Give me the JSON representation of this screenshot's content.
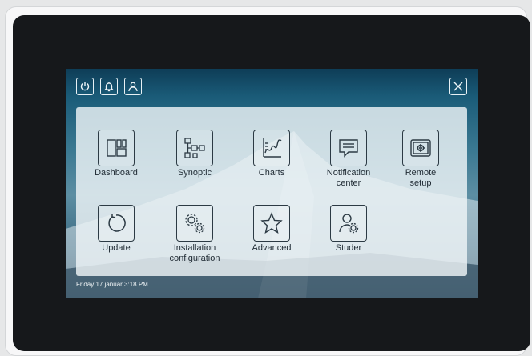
{
  "toolbar": {
    "power_icon": "power-icon",
    "bell_icon": "bell-icon",
    "user_icon": "user-icon",
    "close_icon": "close-icon"
  },
  "tiles": [
    {
      "label": "Dashboard",
      "icon": "dashboard-icon"
    },
    {
      "label": "Synoptic",
      "icon": "synoptic-icon"
    },
    {
      "label": "Charts",
      "icon": "charts-icon"
    },
    {
      "label": "Notification\ncenter",
      "icon": "notification-icon"
    },
    {
      "label": "Remote\nsetup",
      "icon": "remote-setup-icon"
    },
    {
      "label": "Update",
      "icon": "update-icon"
    },
    {
      "label": "Installation\nconfiguration",
      "icon": "installation-config-icon"
    },
    {
      "label": "Advanced",
      "icon": "star-icon"
    },
    {
      "label": "Studer",
      "icon": "studer-user-icon"
    }
  ],
  "status": {
    "datetime": "Friday 17 januar 3:18 PM"
  },
  "colors": {
    "screen_top": "#0e3d57",
    "panel": "#eef4f7",
    "icon_stroke": "#2c3a44",
    "device_bezel": "#16181b"
  }
}
